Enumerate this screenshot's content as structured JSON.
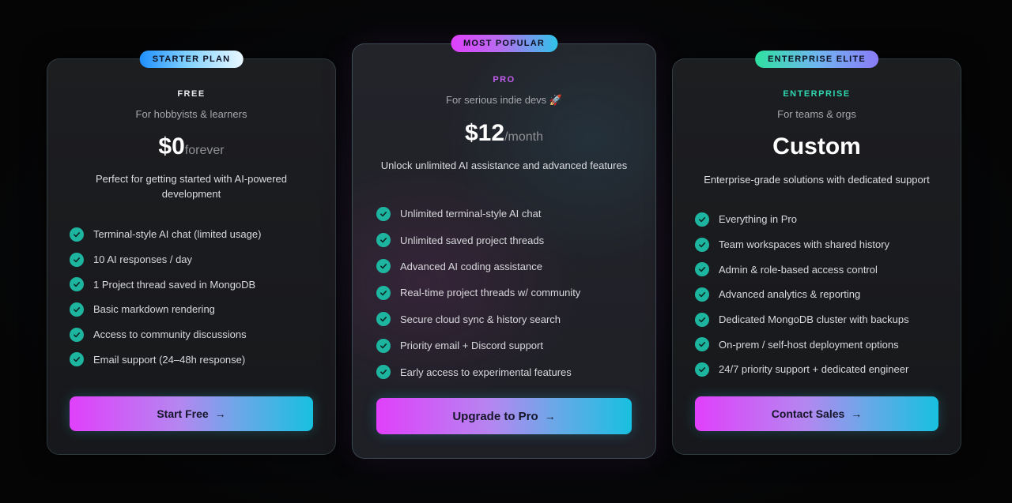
{
  "plans": {
    "starter": {
      "badge": "STARTER PLAN",
      "tier": "FREE",
      "subtitle": "For hobbyists & learners",
      "price": "$0",
      "period": "forever",
      "description": "Perfect for getting started with AI-powered development",
      "features": [
        "Terminal-style AI chat (limited usage)",
        "10 AI responses / day",
        "1 Project thread saved in MongoDB",
        "Basic markdown rendering",
        "Access to community discussions",
        "Email support (24–48h response)"
      ],
      "cta": "Start Free",
      "cta_arrow": "→"
    },
    "pro": {
      "badge": "MOST POPULAR",
      "tier": "PRO",
      "subtitle": "For serious indie devs 🚀",
      "price": "$12",
      "period": "/month",
      "description": "Unlock unlimited AI assistance and advanced features",
      "features": [
        "Unlimited terminal-style AI chat",
        "Unlimited saved project threads",
        "Advanced AI coding assistance",
        "Real-time project threads w/ community",
        "Secure cloud sync & history search",
        "Priority email + Discord support",
        "Early access to experimental features"
      ],
      "cta": "Upgrade to Pro",
      "cta_arrow": "→"
    },
    "enterprise": {
      "badge": "ENTERPRISE ELITE",
      "tier": "ENTERPRISE",
      "subtitle": "For teams & orgs",
      "price": "Custom",
      "period": "",
      "description": "Enterprise-grade solutions with dedicated support",
      "features": [
        "Everything in Pro",
        "Team workspaces with shared history",
        "Admin & role-based access control",
        "Advanced analytics & reporting",
        "Dedicated MongoDB cluster with backups",
        "On-prem / self-host deployment options",
        "24/7 priority support + dedicated engineer"
      ],
      "cta": "Contact Sales",
      "cta_arrow": "→"
    }
  },
  "icons": {
    "feature_check": "check-circle-icon",
    "cta_arrow": "arrow-right-icon"
  },
  "colors": {
    "check": "#1eb5a0",
    "pro_accent": "#c45ef0",
    "enterprise_accent": "#2fd6b0",
    "cta_gradient_start": "#e040fb",
    "cta_gradient_end": "#18c0e0"
  }
}
